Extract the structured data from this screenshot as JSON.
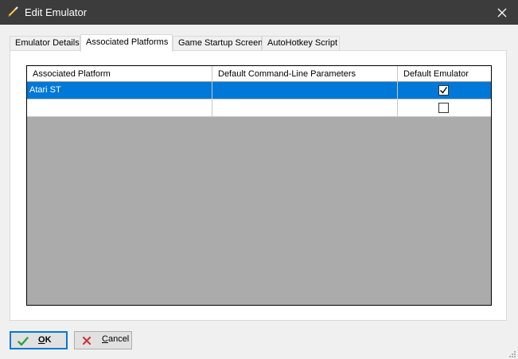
{
  "window": {
    "title": "Edit Emulator",
    "icon": "pencil-icon",
    "close_icon": "close-icon"
  },
  "tabs": [
    {
      "label": "Emulator Details",
      "active": false
    },
    {
      "label": "Associated Platforms",
      "active": true
    },
    {
      "label": "Game Startup Screen",
      "active": false
    },
    {
      "label": "AutoHotkey Script",
      "active": false
    }
  ],
  "grid": {
    "columns": [
      "Associated Platform",
      "Default Command-Line Parameters",
      "Default Emulator"
    ],
    "rows": [
      {
        "platform": "Atari ST",
        "parameters": "",
        "default_emulator": true,
        "selected": true
      },
      {
        "platform": "",
        "parameters": "",
        "default_emulator": false,
        "selected": false
      }
    ]
  },
  "buttons": {
    "ok": {
      "mnemonic": "O",
      "rest": "K",
      "icon": "checkmark-icon"
    },
    "cancel": {
      "mnemonic": "C",
      "rest": "ancel",
      "icon": "x-icon"
    }
  },
  "colors": {
    "titlebar": "#3c3c3c",
    "selection": "#0078d7",
    "grid_background": "#ababab",
    "ok_icon": "#2ea043",
    "cancel_icon": "#d13438"
  }
}
